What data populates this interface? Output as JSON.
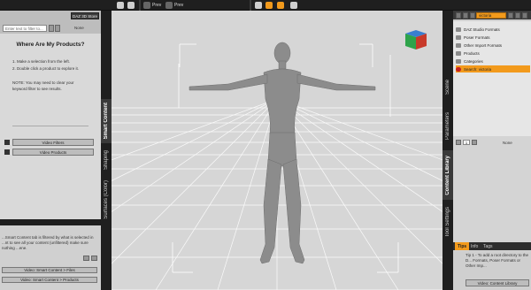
{
  "toolbar": {
    "prev_label": "Prev",
    "next_label": "Prev"
  },
  "left_panel": {
    "store_button": "DAZ 3D Store",
    "filter_placeholder": "Enter text to filter to...",
    "filter_status": "None",
    "title": "Where Are My Products?",
    "steps": [
      "1. Make a selection from the left.",
      "2. Double click a product to explore it."
    ],
    "note": "NOTE: You may need to clear your keyword filter to see results.",
    "video_buttons": [
      "Video Filters",
      "Video Products"
    ],
    "bottom_text": "...Smart Content tab is filtered by what is selected in ...nt to see all your content (unfiltered) make sure nothing ...ene.",
    "bottom_buttons": [
      "Video: Smart Content > Files",
      "Video: Smart Content > Products"
    ],
    "tabs": [
      "Smart Content",
      "Shaping",
      "Surfaces (Color)"
    ]
  },
  "right_panel": {
    "search_value": "victoria",
    "items": [
      {
        "label": "DAZ Studio Formats",
        "selected": false
      },
      {
        "label": "Poser Formats",
        "selected": false
      },
      {
        "label": "Other Import Formats",
        "selected": false
      },
      {
        "label": "Products",
        "selected": false
      },
      {
        "label": "Categories",
        "selected": false
      },
      {
        "label": "Search: victoria",
        "selected": true
      }
    ],
    "page_number": "1",
    "status": "None",
    "tip_tabs": [
      "Tips",
      "Info",
      "Tags"
    ],
    "tip_text": "Tip 1 - To add a root directory to the D... Formats, Poser Formats or Other Imp...",
    "tip_button": "Video: Content Library",
    "tabs": [
      "Scene",
      "Parameters",
      "Content Library",
      "Tool Settings"
    ]
  },
  "colors": {
    "accent": "#f29a1c",
    "viewport_bg": "#d6d6d6",
    "panel_bg": "#cfcfcf",
    "chrome": "#1f1f1f"
  }
}
